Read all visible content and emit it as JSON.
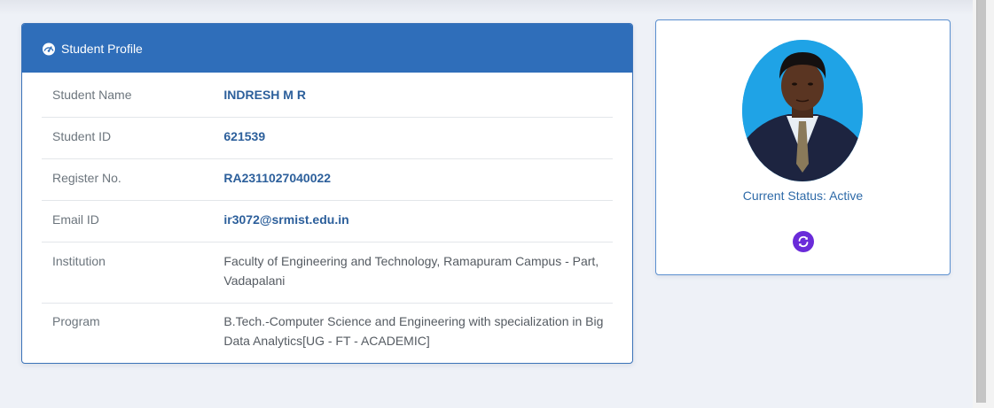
{
  "profile": {
    "header_title": "Student Profile",
    "header_icon": "tachometer-icon",
    "rows": [
      {
        "label": "Student Name",
        "value": "INDRESH M R"
      },
      {
        "label": "Student ID",
        "value": "621539"
      },
      {
        "label": "Register No.",
        "value": "RA2311027040022"
      },
      {
        "label": "Email ID",
        "value": "ir3072@srmist.edu.in"
      },
      {
        "label": "Institution",
        "value": "Faculty of Engineering and Technology, Ramapuram Campus - Part, Vadapalani"
      },
      {
        "label": "Program",
        "value": "B.Tech.-Computer Science and Engineering with specialization in Big Data Analytics[UG - FT - ACADEMIC]"
      }
    ]
  },
  "side": {
    "status_text": "Current Status: Active",
    "refresh_icon": "refresh-icon"
  },
  "colors": {
    "header_blue": "#2f6eba",
    "value_blue": "#2c5f9b",
    "refresh_purple": "#6a2bd9",
    "photo_bg": "#1fa3e6"
  }
}
